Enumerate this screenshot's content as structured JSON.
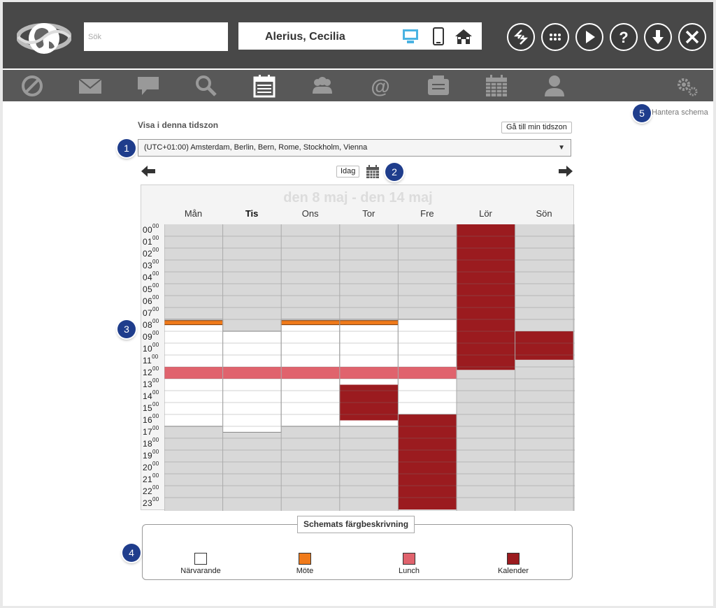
{
  "header": {
    "search_placeholder": "Sök",
    "user_name": "Alerius, Cecilia",
    "view_icons": [
      "desktop-icon",
      "mobile-icon",
      "home-icon"
    ],
    "action_buttons": [
      "switch-icon",
      "apps-grid-icon",
      "play-icon",
      "help-icon",
      "download-icon",
      "close-icon"
    ]
  },
  "toolbar": {
    "icons": [
      "block-icon",
      "mail-icon",
      "chat-icon",
      "search-icon",
      "schedule-icon",
      "group-icon",
      "at-icon",
      "board-icon",
      "calendar-icon",
      "person-icon"
    ],
    "active": "schedule-icon",
    "settings_icon": "gears-icon"
  },
  "manage_schedule": "Hantera schema",
  "badges": [
    "1",
    "2",
    "3",
    "4",
    "5"
  ],
  "timezone": {
    "label": "Visa i denna tidszon",
    "my_timezone_button": "Gå till min tidszon",
    "selected": "(UTC+01:00) Amsterdam, Berlin, Bern, Rome, Stockholm, Vienna"
  },
  "nav": {
    "today": "Idag"
  },
  "calendar": {
    "range_title": "den 8 maj - den 14 maj",
    "days": [
      "Mån",
      "Tis",
      "Ons",
      "Tor",
      "Fre",
      "Lör",
      "Sön"
    ],
    "current_day": "Tis",
    "hours": [
      "00",
      "01",
      "02",
      "03",
      "04",
      "05",
      "06",
      "07",
      "08",
      "09",
      "10",
      "11",
      "12",
      "13",
      "14",
      "15",
      "16",
      "17",
      "18",
      "19",
      "20",
      "21",
      "22",
      "23"
    ],
    "minutes": "00",
    "blocks": [
      {
        "day": 0,
        "type": "present",
        "start": 8,
        "end": 17
      },
      {
        "day": 1,
        "type": "present",
        "start": 9,
        "end": 17.5
      },
      {
        "day": 2,
        "type": "present",
        "start": 8,
        "end": 17
      },
      {
        "day": 3,
        "type": "present",
        "start": 8,
        "end": 17
      },
      {
        "day": 4,
        "type": "present",
        "start": 8,
        "end": 16
      },
      {
        "day": 0,
        "type": "meeting",
        "start": 8.1,
        "end": 8.45
      },
      {
        "day": 2,
        "type": "meeting",
        "start": 8.1,
        "end": 8.45
      },
      {
        "day": 3,
        "type": "meeting",
        "start": 8.1,
        "end": 8.45
      },
      {
        "day": 0,
        "type": "lunch",
        "start": 12,
        "end": 13
      },
      {
        "day": 1,
        "type": "lunch",
        "start": 12,
        "end": 13
      },
      {
        "day": 2,
        "type": "lunch",
        "start": 12,
        "end": 13
      },
      {
        "day": 3,
        "type": "lunch",
        "start": 12,
        "end": 13
      },
      {
        "day": 4,
        "type": "lunch",
        "start": 12,
        "end": 13
      },
      {
        "day": 3,
        "type": "calendar",
        "start": 13.5,
        "end": 16.5
      },
      {
        "day": 4,
        "type": "calendar",
        "start": 16,
        "end": 24
      },
      {
        "day": 5,
        "type": "calendar",
        "start": 0,
        "end": 12.25
      },
      {
        "day": 6,
        "type": "calendar",
        "start": 9,
        "end": 11.4
      }
    ]
  },
  "legend": {
    "title": "Schemats färgbeskrivning",
    "items": [
      {
        "label": "Närvarande",
        "color": "#ffffff"
      },
      {
        "label": "Möte",
        "color": "#f07a1a"
      },
      {
        "label": "Lunch",
        "color": "#e0636d"
      },
      {
        "label": "Kalender",
        "color": "#9b1b1f"
      }
    ]
  },
  "colors": {
    "absent": "#d8d8d8",
    "present": "#ffffff",
    "meeting": "#f07a1a",
    "lunch": "#e0636d",
    "calendar": "#9b1b1f"
  }
}
